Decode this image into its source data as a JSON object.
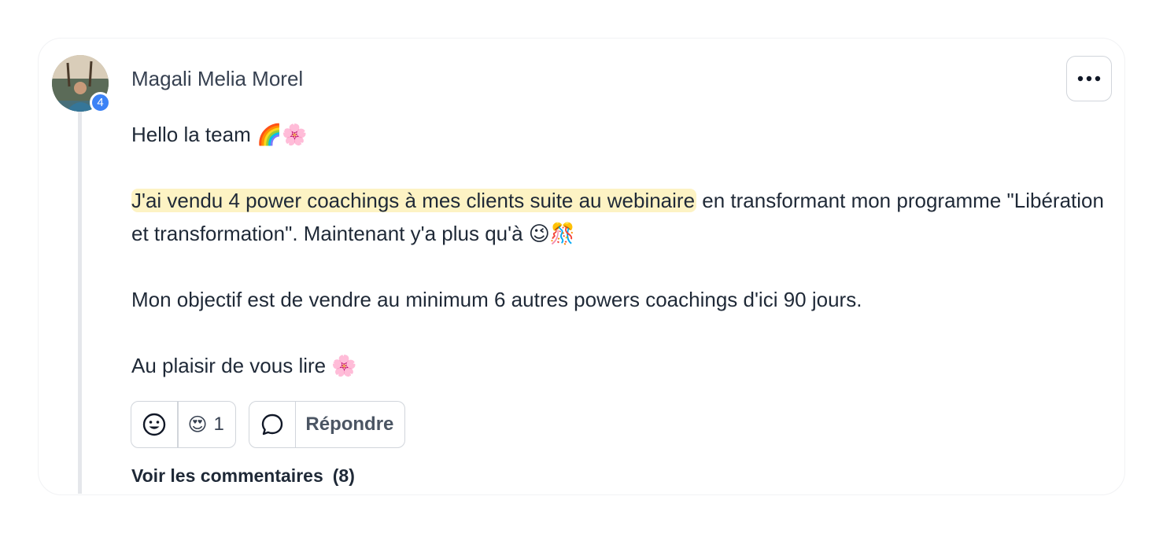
{
  "post": {
    "author": "Magali Melia Morel",
    "level": "4",
    "paragraphs": [
      {
        "text": "Hello la team 🌈🌸"
      },
      {
        "highlight": "J'ai vendu 4 power coachings à mes clients suite au webinaire",
        "text": " en transformant mon programme \"Libération et transformation\". Maintenant y'a plus qu'à 😉🎊"
      },
      {
        "text": "Mon objectif est de vendre au minimum 6 autres powers coachings d'ici 90 jours."
      },
      {
        "text": "Au plaisir de vous lire 🌸"
      }
    ]
  },
  "actions": {
    "reaction_emoji": "😍",
    "reaction_count": "1",
    "reply_label": "Répondre"
  },
  "comments": {
    "label": "Voir les commentaires",
    "count": "(8)"
  },
  "icons": {
    "more": "more-horizontal-icon",
    "add_reaction": "smiley-icon",
    "reply": "speech-bubble-icon"
  },
  "colors": {
    "badge": "#3b82f6",
    "highlight": "#fdf3c4",
    "border": "#d1d5db"
  }
}
